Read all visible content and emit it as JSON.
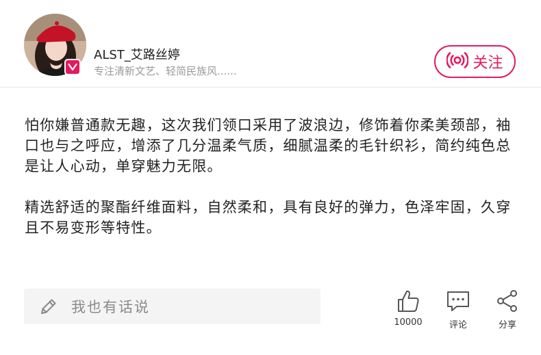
{
  "author": {
    "name": "ALST_艾路丝婷",
    "description": "专注清新文艺、轻简民族风......",
    "avatar_icon": "avatar-portrait-icon",
    "badge_icon": "v-badge-icon"
  },
  "follow": {
    "label": "关注",
    "icon": "broadcast-icon",
    "color": "#e5195f"
  },
  "content": {
    "paragraphs": [
      "怕你嫌普通款无趣，这次我们领口采用了波浪边，修饰着你柔美颈部，袖口也与之呼应，增添了几分温柔气质，细腻温柔的毛针织衫，简约纯色总是让人心动，单穿魅力无限。",
      "精选舒适的聚酯纤维面料，自然柔和，具有良好的弹力，色泽牢固，久穿且不易变形等特性。"
    ]
  },
  "comment_input": {
    "placeholder": "我也有话说",
    "icon": "pencil-icon"
  },
  "actions": {
    "like": {
      "label": "10000",
      "icon": "thumbs-up-icon"
    },
    "comment": {
      "label": "评论",
      "icon": "comment-bubble-icon"
    },
    "share": {
      "label": "分享",
      "icon": "share-icon"
    }
  }
}
